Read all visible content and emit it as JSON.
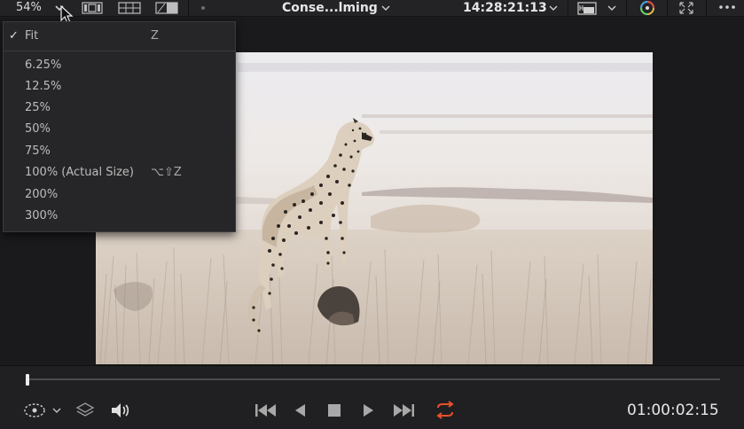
{
  "toolbar": {
    "zoom_value": "54%",
    "clip_title": "Conse...lming",
    "timecode": "14:28:21:13"
  },
  "zoom_menu": {
    "items": [
      {
        "label": "Fit",
        "shortcut": "Z",
        "checked": true
      },
      {
        "label": "6.25%",
        "shortcut": ""
      },
      {
        "label": "12.5%",
        "shortcut": ""
      },
      {
        "label": "25%",
        "shortcut": ""
      },
      {
        "label": "50%",
        "shortcut": ""
      },
      {
        "label": "75%",
        "shortcut": ""
      },
      {
        "label": "100% (Actual Size)",
        "shortcut": "⌥⇧Z"
      },
      {
        "label": "200%",
        "shortcut": ""
      },
      {
        "label": "300%",
        "shortcut": ""
      }
    ]
  },
  "transport": {
    "timecode": "01:00:02:15",
    "playhead_fraction": 0.0
  },
  "colors": {
    "accent_loop": "#e8502a",
    "background": "#1c1c1e"
  }
}
